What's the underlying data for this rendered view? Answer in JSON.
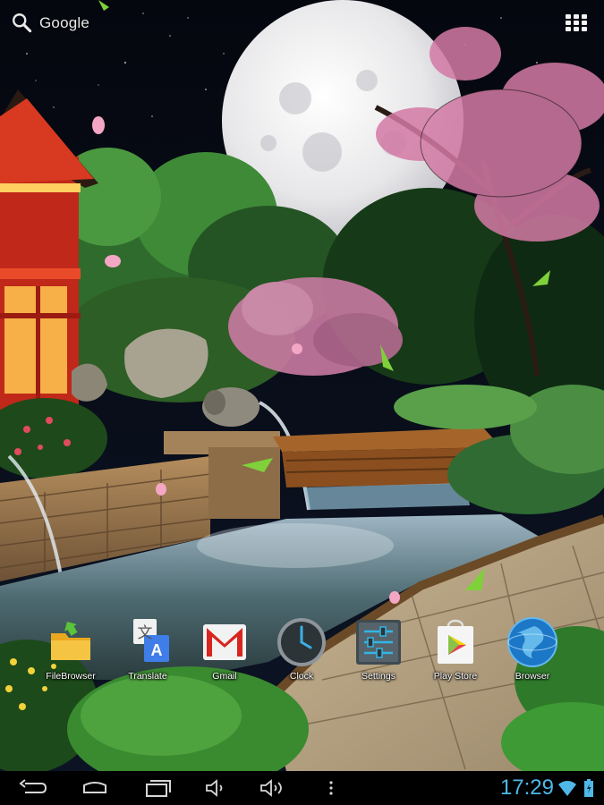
{
  "search": {
    "label": "Google",
    "icon": "search-icon"
  },
  "all_apps": {
    "icon": "apps-grid-icon"
  },
  "dock": {
    "apps": [
      {
        "label": "FileBrowser",
        "icon": "folder-icon"
      },
      {
        "label": "Translate",
        "icon": "translate-icon"
      },
      {
        "label": "Gmail",
        "icon": "gmail-icon"
      },
      {
        "label": "Clock",
        "icon": "clock-icon"
      },
      {
        "label": "Settings",
        "icon": "settings-icon"
      },
      {
        "label": "Play Store",
        "icon": "play-store-icon"
      },
      {
        "label": "Browser",
        "icon": "globe-icon"
      }
    ]
  },
  "navbar": {
    "buttons": [
      "back-icon",
      "home-icon",
      "recents-icon",
      "volume-down-icon",
      "volume-up-icon",
      "menu-icon"
    ],
    "time": "17:29",
    "time_color": "#4fb8e8"
  },
  "icon_text": {
    "translate_left": "文",
    "translate_right": "A"
  }
}
